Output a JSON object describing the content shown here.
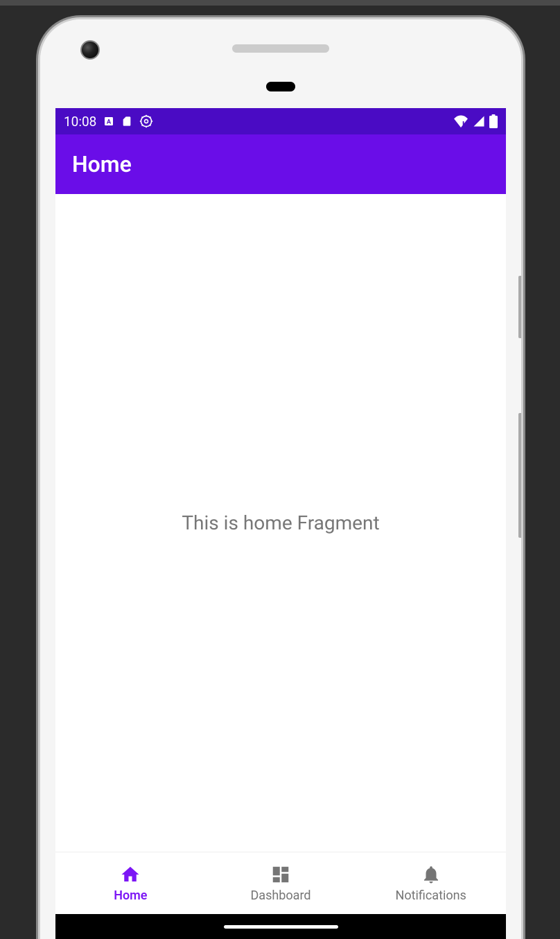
{
  "statusBar": {
    "time": "10:08"
  },
  "appBar": {
    "title": "Home"
  },
  "content": {
    "text": "This is home Fragment"
  },
  "bottomNav": {
    "items": {
      "home": {
        "label": "Home"
      },
      "dashboard": {
        "label": "Dashboard"
      },
      "notifications": {
        "label": "Notifications"
      }
    }
  }
}
